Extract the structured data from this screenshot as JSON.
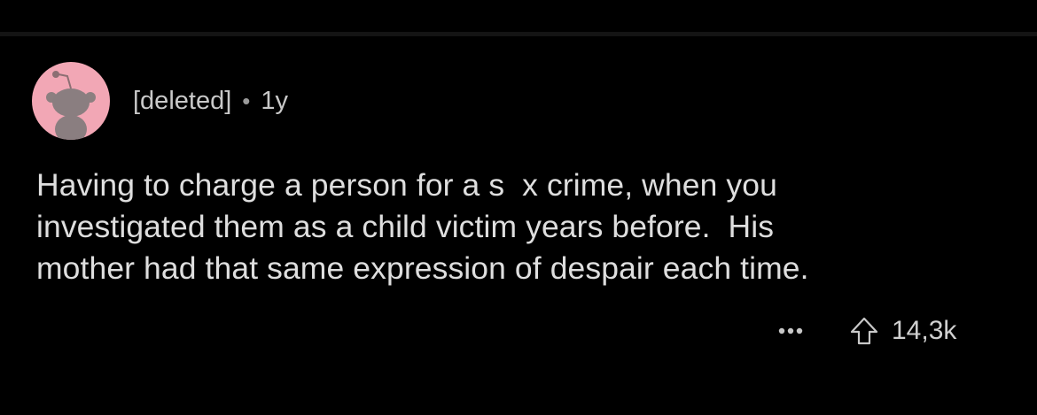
{
  "comment": {
    "author": "[deleted]",
    "separator": "•",
    "age": "1y",
    "body": "Having to charge a person for a s  x crime, when you\ninvestigated them as a child victim years before.  His\nmother had that same expression of despair each time.",
    "upvotes": "14,3k"
  },
  "icons": {
    "avatar": "snoo-avatar-icon",
    "more": "more-options-icon",
    "upvote": "upvote-arrow-icon"
  },
  "colors": {
    "background": "#000000",
    "avatar_bg": "#f2a7b5",
    "text": "#dedede"
  }
}
